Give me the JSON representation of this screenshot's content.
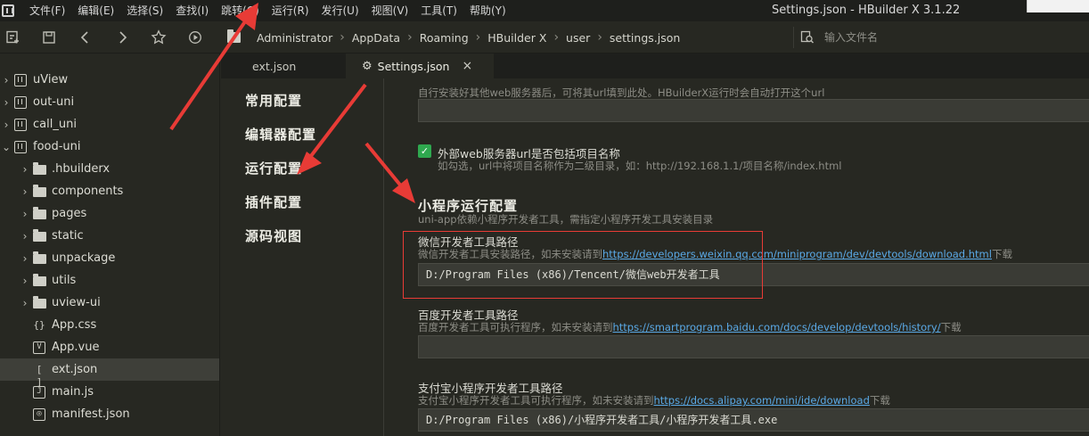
{
  "menubar": {
    "items": [
      "文件(F)",
      "编辑(E)",
      "选择(S)",
      "查找(I)",
      "跳转(G)",
      "运行(R)",
      "发行(U)",
      "视图(V)",
      "工具(T)",
      "帮助(Y)"
    ],
    "window_title": "Settings.json - HBuilder X 3.1.22"
  },
  "toolbar": {
    "icons": [
      "new-file-icon",
      "save-icon",
      "back-icon",
      "forward-icon",
      "star-icon",
      "run-icon"
    ],
    "breadcrumb": [
      "Administrator",
      "AppData",
      "Roaming",
      "HBuilder X",
      "user",
      "settings.json"
    ],
    "search_placeholder": "输入文件名"
  },
  "sidebar": {
    "items": [
      {
        "label": "uView",
        "type": "project",
        "level": 0
      },
      {
        "label": "out-uni",
        "type": "project",
        "level": 0
      },
      {
        "label": "call_uni",
        "type": "project",
        "level": 0
      },
      {
        "label": "food-uni",
        "type": "project",
        "level": 0,
        "expanded": true
      },
      {
        "label": ".hbuilderx",
        "type": "folder",
        "level": 1
      },
      {
        "label": "components",
        "type": "folder",
        "level": 1
      },
      {
        "label": "pages",
        "type": "folder",
        "level": 1
      },
      {
        "label": "static",
        "type": "folder",
        "level": 1
      },
      {
        "label": "unpackage",
        "type": "folder",
        "level": 1
      },
      {
        "label": "utils",
        "type": "folder",
        "level": 1
      },
      {
        "label": "uview-ui",
        "type": "folder",
        "level": 1
      },
      {
        "label": "App.css",
        "type": "css",
        "level": 1
      },
      {
        "label": "App.vue",
        "type": "vue",
        "level": 1
      },
      {
        "label": "ext.json",
        "type": "json",
        "level": 1,
        "active": true
      },
      {
        "label": "main.js",
        "type": "js",
        "level": 1
      },
      {
        "label": "manifest.json",
        "type": "json-config",
        "level": 1
      }
    ]
  },
  "tabs": [
    {
      "label": "ext.json",
      "active": false
    },
    {
      "label": "Settings.json",
      "active": true,
      "close": "×"
    }
  ],
  "settings_nav": [
    "常用配置",
    "编辑器配置",
    "运行配置",
    "插件配置",
    "源码视图"
  ],
  "content": {
    "web_server_hint": "自行安装好其他web服务器后，可将其url填到此处。HBuilderX运行时会自动打开这个url",
    "web_server_value": "",
    "include_project_label": "外部web服务器url是否包括项目名称",
    "include_project_checked": true,
    "include_project_hint": "如勾选，url中将项目名称作为二级目录，如：http://192.168.1.1/项目名称/index.html",
    "miniprogram_title": "小程序运行配置",
    "miniprogram_subtitle": "uni-app依赖小程序开发者工具，需指定小程序开发工具安装目录",
    "wechat": {
      "label": "微信开发者工具路径",
      "hint_prefix": "微信开发者工具安装路径，如未安装请到",
      "link": "https://developers.weixin.qq.com/miniprogram/dev/devtools/download.html",
      "hint_suffix": "下载",
      "value": "D:/Program Files (x86)/Tencent/微信web开发者工具"
    },
    "baidu": {
      "label": "百度开发者工具路径",
      "hint_prefix": "百度开发者工具可执行程序，如未安装请到",
      "link": "https://smartprogram.baidu.com/docs/develop/devtools/history/",
      "hint_suffix": "下载",
      "value": ""
    },
    "alipay": {
      "label": "支付宝小程序开发者工具路径",
      "hint_prefix": "支付宝小程序开发者工具可执行程序，如未安装请到",
      "link": "https://docs.alipay.com/mini/ide/download",
      "hint_suffix": "下载",
      "value": "D:/Program Files (x86)/小程序开发者工具/小程序开发者工具.exe"
    }
  },
  "colors": {
    "background": "#272822",
    "accent_red": "#e83b36",
    "link": "#5aa9e6",
    "checkbox": "#2fa84f"
  }
}
